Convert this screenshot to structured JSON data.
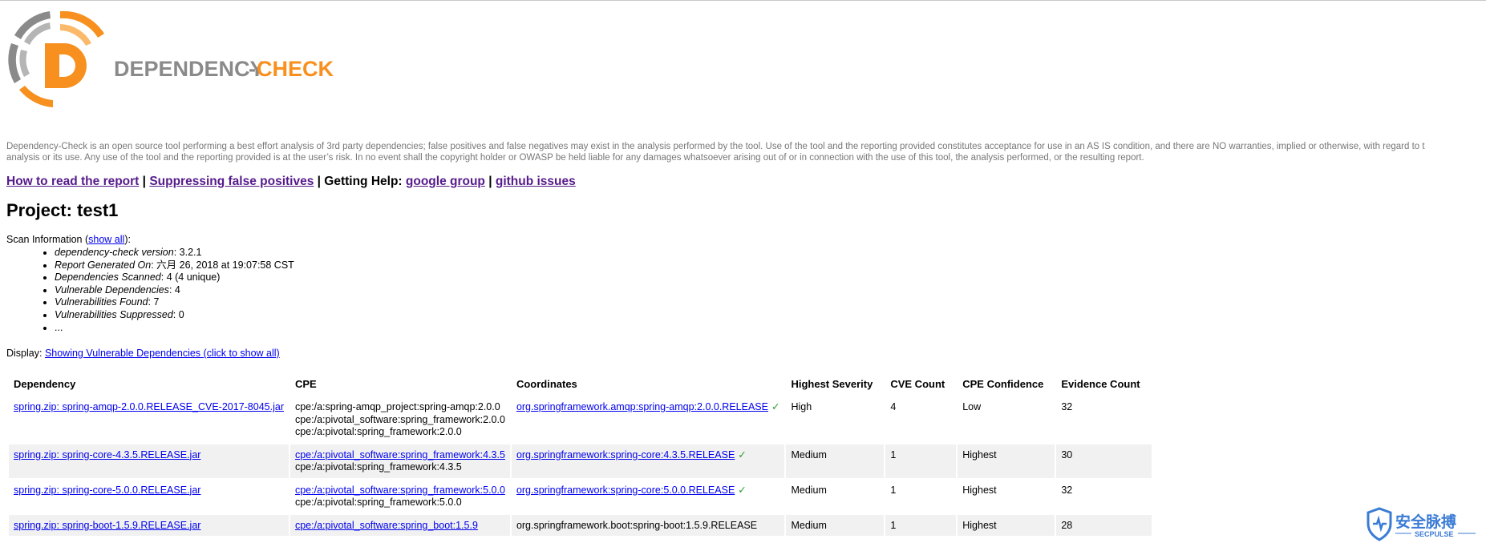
{
  "logo": {
    "text_dependency": "DEPENDENCY",
    "text_dash": "-",
    "text_check": "CHECK",
    "letter": "D"
  },
  "disclaimer": {
    "line1": "Dependency-Check is an open source tool performing a best effort analysis of 3rd party dependencies; false positives and false negatives may exist in the analysis performed by the tool. Use of the tool and the reporting provided constitutes acceptance for use in an AS IS condition, and there are NO warranties, implied or otherwise, with regard to t",
    "line2": "analysis or its use. Any use of the tool and the reporting provided is at the user’s risk. In no event shall the copyright holder or OWASP be held liable for any damages whatsoever arising out of or in connection with the use of this tool, the analysis performed, or the resulting report."
  },
  "help": {
    "how_to_read": "How to read the report",
    "sep1": " | ",
    "suppressing": "Suppressing false positives",
    "sep2": " | ",
    "getting_help": "Getting Help: ",
    "google_group": "google group",
    "sep3": " | ",
    "github_issues": "github issues"
  },
  "project": {
    "title": "Project: test1"
  },
  "scan": {
    "label": "Scan Information (",
    "show_all": "show all",
    "label_end": "):",
    "items": [
      {
        "key": "dependency-check version",
        "value": ": 3.2.1"
      },
      {
        "key": "Report Generated On",
        "value": ": 六月 26, 2018 at 19:07:58 CST"
      },
      {
        "key": "Dependencies Scanned",
        "value": ": 4 (4 unique)"
      },
      {
        "key": "Vulnerable Dependencies",
        "value": ": 4"
      },
      {
        "key": "Vulnerabilities Found",
        "value": ": 7"
      },
      {
        "key": "Vulnerabilities Suppressed",
        "value": ": 0"
      },
      {
        "key": "",
        "value": "..."
      }
    ]
  },
  "display": {
    "label": "Display: ",
    "link": "Showing Vulnerable Dependencies (click to show all)"
  },
  "table": {
    "headers": [
      "Dependency",
      "CPE",
      "Coordinates",
      "Highest Severity",
      "CVE Count",
      "CPE Confidence",
      "Evidence Count"
    ],
    "rows": [
      {
        "dependency": "spring.zip: spring-amqp-2.0.0.RELEASE_CVE-2017-8045.jar",
        "cpe_link": "",
        "cpe_lines": [
          "cpe:/a:spring-amqp_project:spring-amqp:2.0.0",
          "cpe:/a:pivotal_software:spring_framework:2.0.0",
          "cpe:/a:pivotal:spring_framework:2.0.0"
        ],
        "coordinates": "org.springframework.amqp:spring-amqp:2.0.0.RELEASE",
        "coordinates_linked": true,
        "check": "✓",
        "severity": "High",
        "cve_count": "4",
        "confidence": "Low",
        "evidence": "32"
      },
      {
        "dependency": "spring.zip: spring-core-4.3.5.RELEASE.jar",
        "cpe_link": "cpe:/a:pivotal_software:spring_framework:4.3.5",
        "cpe_lines": [
          "cpe:/a:pivotal:spring_framework:4.3.5"
        ],
        "coordinates": "org.springframework:spring-core:4.3.5.RELEASE",
        "coordinates_linked": true,
        "check": "✓",
        "severity": "Medium",
        "cve_count": "1",
        "confidence": "Highest",
        "evidence": "30"
      },
      {
        "dependency": "spring.zip: spring-core-5.0.0.RELEASE.jar",
        "cpe_link": "cpe:/a:pivotal_software:spring_framework:5.0.0",
        "cpe_lines": [
          "cpe:/a:pivotal:spring_framework:5.0.0"
        ],
        "coordinates": "org.springframework:spring-core:5.0.0.RELEASE",
        "coordinates_linked": true,
        "check": "✓",
        "severity": "Medium",
        "cve_count": "1",
        "confidence": "Highest",
        "evidence": "32"
      },
      {
        "dependency": "spring.zip: spring-boot-1.5.9.RELEASE.jar",
        "cpe_link": "cpe:/a:pivotal_software:spring_boot:1.5.9",
        "cpe_lines": [],
        "coordinates": "org.springframework.boot:spring-boot:1.5.9.RELEASE",
        "coordinates_linked": false,
        "check": "",
        "severity": "Medium",
        "cve_count": "1",
        "confidence": "Highest",
        "evidence": "28"
      }
    ]
  },
  "watermark": {
    "cn": "安全脉搏",
    "en": "SECPULSE"
  },
  "colors": {
    "orange": "#f7901e",
    "gray": "#8a8a8a",
    "link": "#0000ee",
    "visited": "#551a8b",
    "alt_row": "#f1f1f1"
  }
}
